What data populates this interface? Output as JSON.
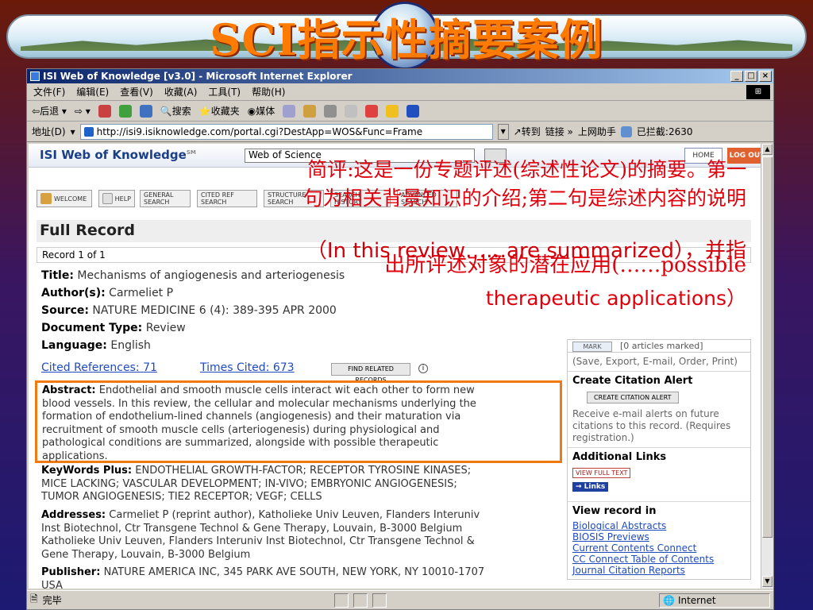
{
  "slide": {
    "title": "SCI指示性摘要案例",
    "annotation": {
      "line1": "简评:这是一份专题评述(综述性论文)的摘要。第一",
      "line2": "句为相关背景知识的介绍;第二句是综述内容的说明",
      "line3": "（In this review……are summarized），并指",
      "line4": "出所评述对象的潜在应用(……possible",
      "line5": "therapeutic applications）"
    },
    "accent_color": "#ff7a00",
    "annotation_color": "#e0000c"
  },
  "browser": {
    "title": "ISI Web of Knowledge [v3.0] - Microsoft Internet Explorer",
    "menu": [
      "文件(F)",
      "编辑(E)",
      "查看(V)",
      "收藏(A)",
      "工具(T)",
      "帮助(H)"
    ],
    "toolbar": {
      "back": "后退",
      "search": "搜索",
      "favorites": "收藏夹",
      "media": "媒体"
    },
    "address_label": "地址(D)",
    "address_url": "http://isi9.isiknowledge.com/portal.cgi?DestApp=WOS&Func=Frame",
    "go_label": "转到",
    "links_label": "链接",
    "helper_label": "上网助手",
    "blocked_label": "已拦截:2630",
    "status_text": "完毕",
    "zone_text": "Internet"
  },
  "isi": {
    "logo": "ISI Web of Knowledge",
    "logo_sm": "SM",
    "db_select": "Web of Science",
    "home": "HOME",
    "logout": "LOG OUT",
    "nav": {
      "welcome": "WELCOME",
      "help": "HELP",
      "general_search": "GENERAL SEARCH",
      "cited_ref_search": "CITED REF SEARCH",
      "structure_search": "STRUCTURE SEARCH",
      "search_history": "SEARCH HISTORY",
      "advanced_search": "ADVANCED SEARCH"
    },
    "full_record": "Full Record",
    "record_num": "Record 1 of 1",
    "title_label": "Title:",
    "title_value": "Mechanisms of angiogenesis and arteriogenesis",
    "author_label": "Author(s):",
    "author_value": "Carmeliet P",
    "source_label": "Source:",
    "source_value": "NATURE MEDICINE 6 (4): 389-395 APR 2000",
    "doctype_label": "Document Type:",
    "doctype_value": "Review",
    "language_label": "Language:",
    "language_value": "English",
    "cited_refs": "Cited References: 71",
    "times_cited": "Times Cited: 673",
    "find_related": "FIND RELATED RECORDS",
    "abstract_label": "Abstract:",
    "abstract_lines": [
      "Endothelial and smooth muscle cells interact wit each other to form new",
      "blood vessels. In this review, the cellular and molecular mechanisms underlying the",
      "formation of endothelium-lined channels (angiogenesis) and their maturation via",
      "recruitment of smooth muscle cells (arteriogenesis) during physiological and",
      "pathological conditions are summarized, alongside with possible therapeutic",
      "applications."
    ],
    "keywords_label": "KeyWords Plus:",
    "keywords_lines": [
      "ENDOTHELIAL GROWTH-FACTOR; RECEPTOR TYROSINE KINASES;",
      "MICE LACKING; VASCULAR DEVELOPMENT; IN-VIVO; EMBRYONIC ANGIOGENESIS;",
      "TUMOR ANGIOGENESIS; TIE2 RECEPTOR; VEGF; CELLS"
    ],
    "addresses_label": "Addresses:",
    "addresses_lines": [
      "Carmeliet P (reprint author), Katholieke Univ Leuven, Flanders Interuniv",
      "Inst Biotechnol, Ctr Transgene Technol & Gene Therapy, Louvain, B-3000 Belgium",
      "Katholieke Univ Leuven, Flanders Interuniv Inst Biotechnol, Ctr Transgene Technol &",
      "Gene Therapy, Louvain, B-3000 Belgium"
    ],
    "publisher_label": "Publisher:",
    "publisher_value": "NATURE AMERICA INC, 345 PARK AVE SOUTH, NEW YORK, NY 10010-1707",
    "publisher_line2": "USA",
    "panel": {
      "mark_btn": "MARK",
      "marked": "[0 articles marked]",
      "save_hint": "(Save, Export, E-mail, Order, Print)",
      "citation_alert": "Create Citation Alert",
      "create_alert_btn": "CREATE CITATION ALERT",
      "alert_desc": "Receive e-mail alerts on future citations to this record. (Requires registration.)",
      "additional_links": "Additional Links",
      "view_full_text": "VIEW FULL TEXT",
      "links_btn": "→ Links",
      "view_record_in": "View record in",
      "view_links": [
        "Biological Abstracts",
        "BIOSIS Previews",
        "Current Contents Connect",
        "CC Connect Table of Contents",
        "Journal Citation Reports"
      ]
    }
  }
}
